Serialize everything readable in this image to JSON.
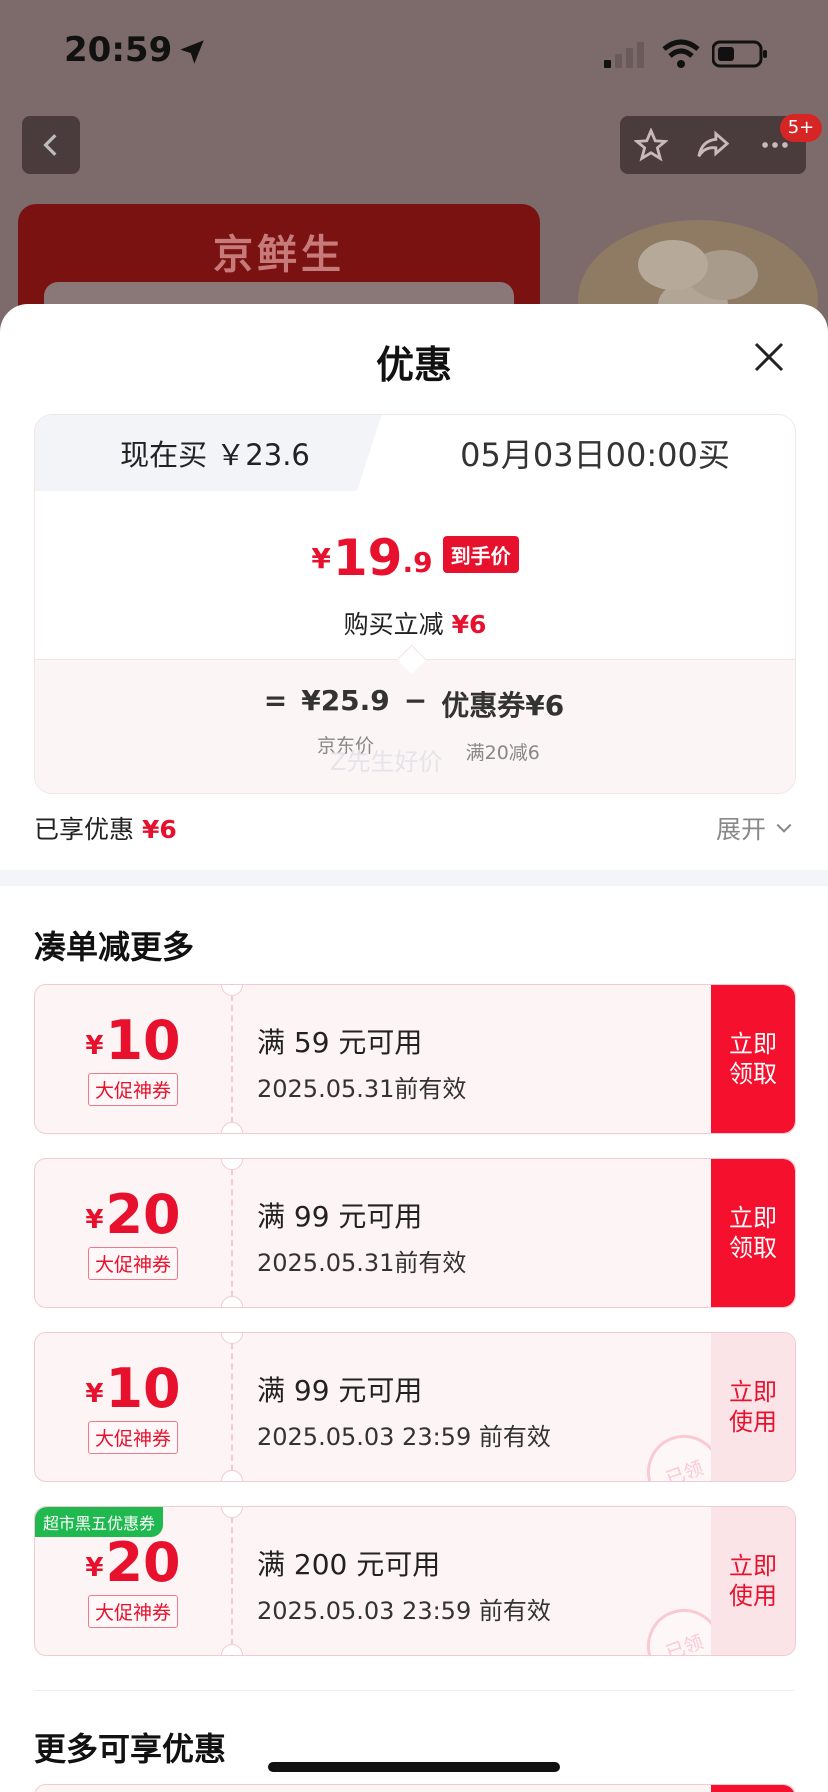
{
  "status_bar": {
    "time": "20:59"
  },
  "background_page": {
    "banner_title": "京鲜生",
    "notification_badge": "5+"
  },
  "sheet": {
    "title": "优惠",
    "compare": {
      "tab_now": "现在买 ￥23.6",
      "tab_later": "05月03日00:00买",
      "final_price_yen": "¥",
      "final_price_int": "19",
      "final_price_dec": ".9",
      "final_price_tag": "到手价",
      "instant_label": "购买立减",
      "instant_amount": "¥6",
      "formula": {
        "equals": "=",
        "jd_price": "¥25.9",
        "jd_price_label": "京东价",
        "minus": "−",
        "coupon": "优惠券¥6",
        "coupon_label": "满20减6"
      }
    },
    "enjoyed_label": "已享优惠",
    "enjoyed_amount": "¥6",
    "expand_label": "展开",
    "watermark": "Z先生好价",
    "section_more_title": "凑单减更多",
    "coupons": [
      {
        "yen": "¥",
        "amount": "10",
        "tag": "大促神券",
        "condition": "满 59 元可用",
        "expiry": "2025.05.31前有效",
        "action": "立即领取",
        "corner": ""
      },
      {
        "yen": "¥",
        "amount": "20",
        "tag": "大促神券",
        "condition": "满 99 元可用",
        "expiry": "2025.05.31前有效",
        "action": "立即领取",
        "corner": ""
      },
      {
        "yen": "¥",
        "amount": "10",
        "tag": "大促神券",
        "condition": "满 99 元可用",
        "expiry": "2025.05.03 23:59 前有效",
        "action": "立即使用",
        "stamp": "已领",
        "corner": ""
      },
      {
        "yen": "¥",
        "amount": "20",
        "tag": "大促神券",
        "condition": "满 200 元可用",
        "expiry": "2025.05.03 23:59 前有效",
        "action": "立即使用",
        "stamp": "已领",
        "corner": "超市黑五优惠券"
      }
    ],
    "section_extra_title": "更多可享优惠"
  }
}
